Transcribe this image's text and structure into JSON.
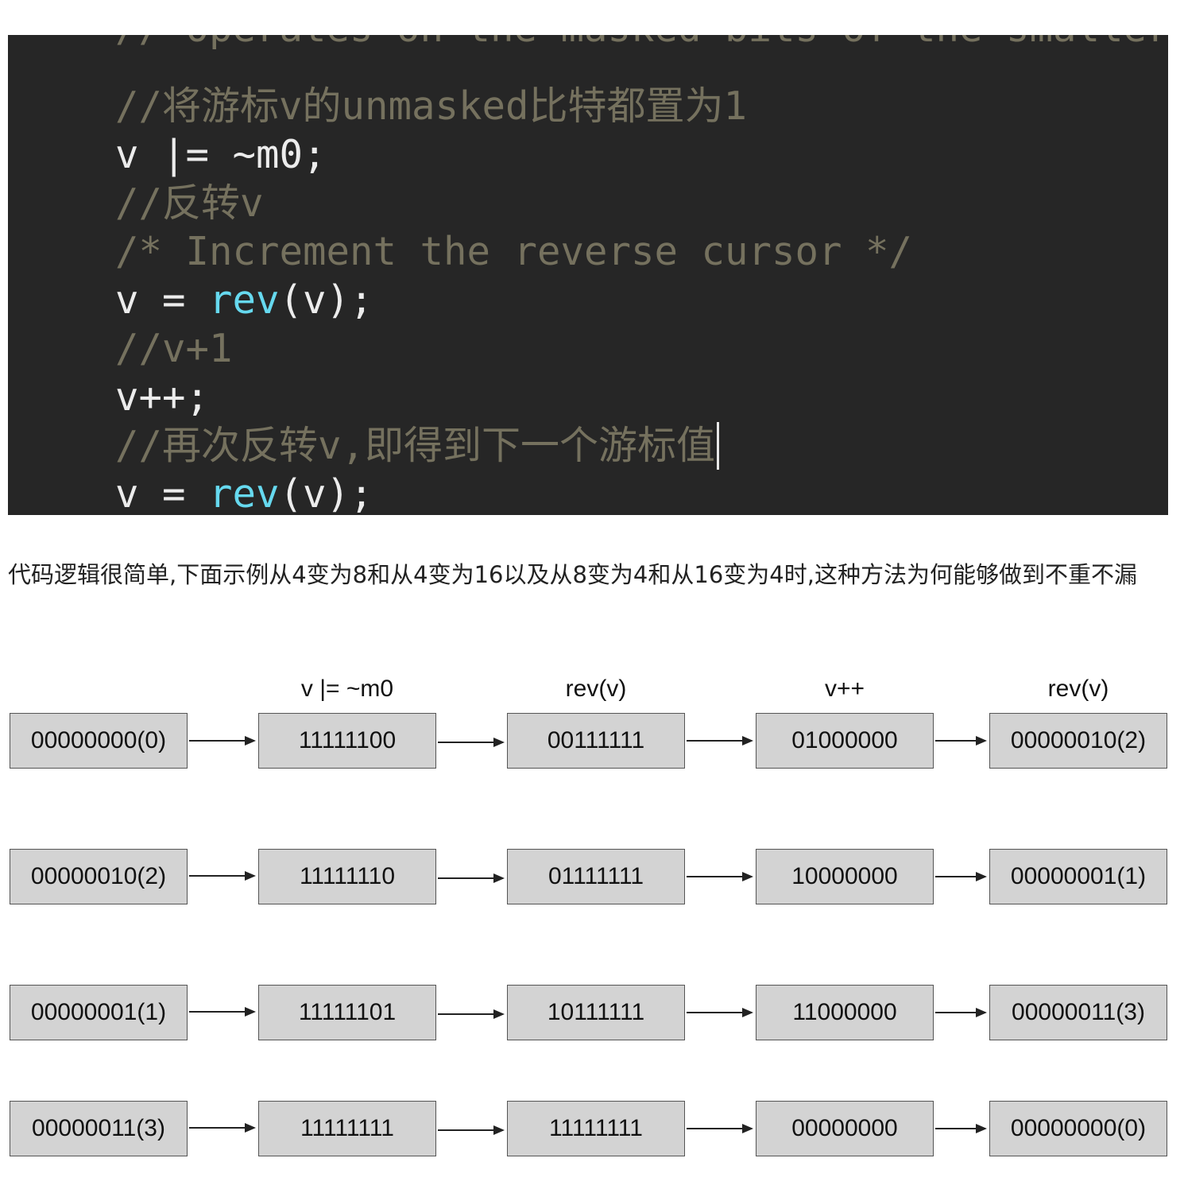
{
  "code": {
    "lines": [
      {
        "kind": "comment",
        "text": "// Operates on the masked bits of the smaller"
      },
      {
        "kind": "comment",
        "text": "//将游标v的unmasked比特都置为1"
      },
      {
        "kind": "code",
        "text": "v |= ~m0;"
      },
      {
        "kind": "comment",
        "text": "//反转v"
      },
      {
        "kind": "comment",
        "text": "/* Increment the reverse cursor */"
      },
      {
        "kind": "code",
        "pre": "v = ",
        "fn": "rev",
        "post": "(v);"
      },
      {
        "kind": "comment",
        "text": "//v+1"
      },
      {
        "kind": "code",
        "text": "v++;"
      },
      {
        "kind": "comment",
        "text": "//再次反转v,即得到下一个游标值"
      },
      {
        "kind": "code",
        "pre": "v = ",
        "fn": "rev",
        "post": "(v);"
      }
    ]
  },
  "paragraph": "代码逻辑很简单,下面示例从4变为8和从4变为16以及从8变为4和从16变为4时,这种方法为何能够做到不重不漏",
  "diagram": {
    "column_labels": [
      "",
      "v |= ~m0",
      "rev(v)",
      "v++",
      "rev(v)"
    ],
    "rows": [
      [
        "00000000(0)",
        "11111100",
        "00111111",
        "01000000",
        "00000010(2)"
      ],
      [
        "00000010(2)",
        "11111110",
        "01111111",
        "10000000",
        "00000001(1)"
      ],
      [
        "00000001(1)",
        "11111101",
        "10111111",
        "11000000",
        "00000011(3)"
      ],
      [
        "00000011(3)",
        "11111111",
        "11111111",
        "00000000",
        "00000000(0)"
      ]
    ]
  }
}
